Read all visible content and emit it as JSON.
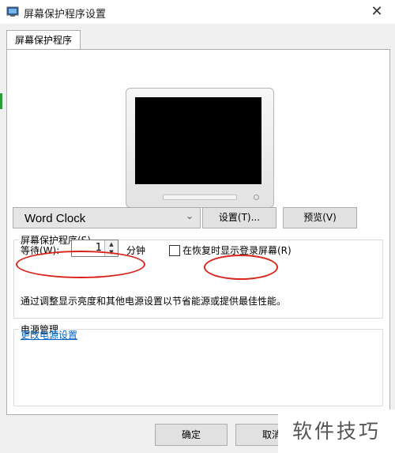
{
  "window": {
    "title": "屏幕保护程序设置",
    "close_glyph": "✕"
  },
  "tab": {
    "label": "屏幕保护程序"
  },
  "screensaver": {
    "group_label": "屏幕保护程序(S)",
    "selected": "Word Clock",
    "settings_label": "设置(T)...",
    "preview_label": "预览(V)",
    "wait_label": "等待(W):",
    "wait_value": "1",
    "wait_unit": "分钟",
    "resume_label": "在恢复时显示登录屏幕(R)",
    "resume_checked": false
  },
  "power": {
    "group_label": "电源管理",
    "description": "通过调整显示亮度和其他电源设置以节省能源或提供最佳性能。",
    "link": "更改电源设置"
  },
  "footer": {
    "ok_label": "确定",
    "cancel_label": "取消"
  },
  "watermark": "软件技巧",
  "colors": {
    "annotation": "#d9231a",
    "link": "#0066cc",
    "accent_strip": "#2a9d3a"
  }
}
